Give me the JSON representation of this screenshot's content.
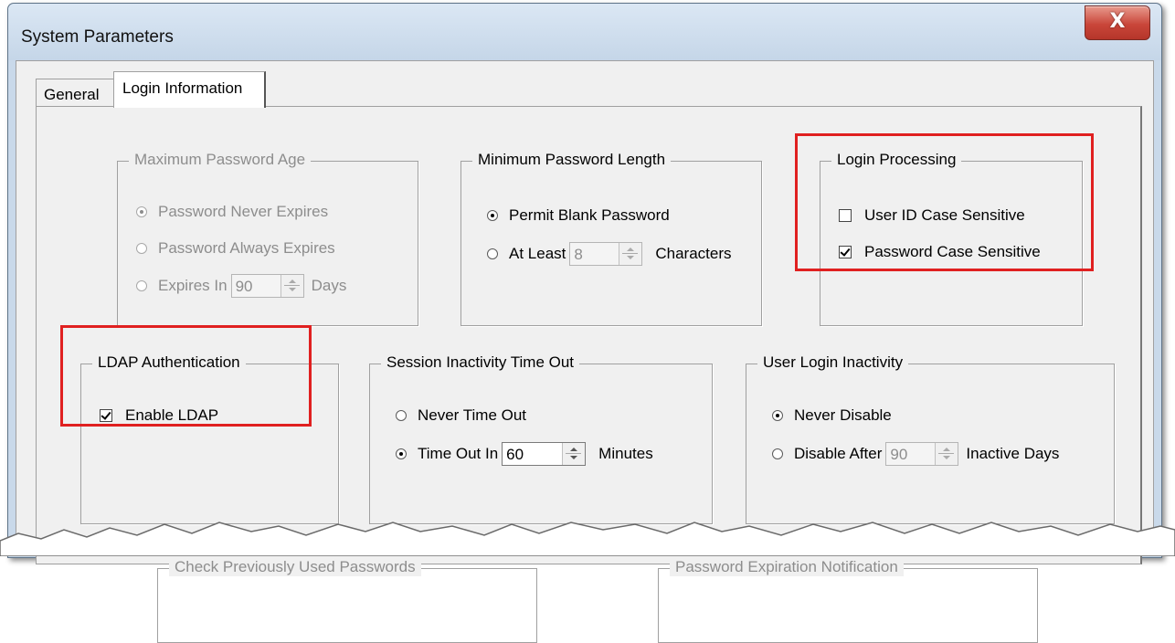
{
  "window": {
    "title": "System Parameters",
    "close_glyph": "X"
  },
  "tabs": [
    {
      "label": "General",
      "active": false
    },
    {
      "label": "Login Information",
      "active": true
    }
  ],
  "groups": {
    "max_password_age": {
      "title": "Maximum Password Age",
      "enabled": false,
      "options": [
        "Password Never Expires",
        "Password Always Expires",
        "Expires In"
      ],
      "selected": 0,
      "days_value": "90",
      "days_suffix": "Days"
    },
    "min_password_length": {
      "title": "Minimum Password Length",
      "options": [
        "Permit Blank Password",
        "At Least"
      ],
      "selected": 0,
      "value": "8",
      "suffix": "Characters"
    },
    "login_processing": {
      "title": "Login Processing",
      "user_id_case_label": "User ID Case Sensitive",
      "user_id_case_checked": false,
      "password_case_label": "Password Case Sensitive",
      "password_case_checked": true
    },
    "ldap": {
      "title": "LDAP Authentication",
      "enable_label": "Enable LDAP",
      "enable_checked": true
    },
    "session_timeout": {
      "title": "Session Inactivity Time Out",
      "options": [
        "Never Time Out",
        "Time Out In"
      ],
      "selected": 1,
      "value": "60",
      "suffix": "Minutes"
    },
    "user_login_inactivity": {
      "title": "User Login Inactivity",
      "options": [
        "Never Disable",
        "Disable After"
      ],
      "selected": 0,
      "value": "90",
      "suffix": "Inactive Days"
    },
    "check_previous": {
      "title": "Check Previously Used Passwords"
    },
    "expiration_notification": {
      "title": "Password Expiration Notification"
    }
  },
  "colors": {
    "highlight": "#e02020",
    "frame": "#c9d9ea",
    "dialog": "#f0f0f0"
  }
}
